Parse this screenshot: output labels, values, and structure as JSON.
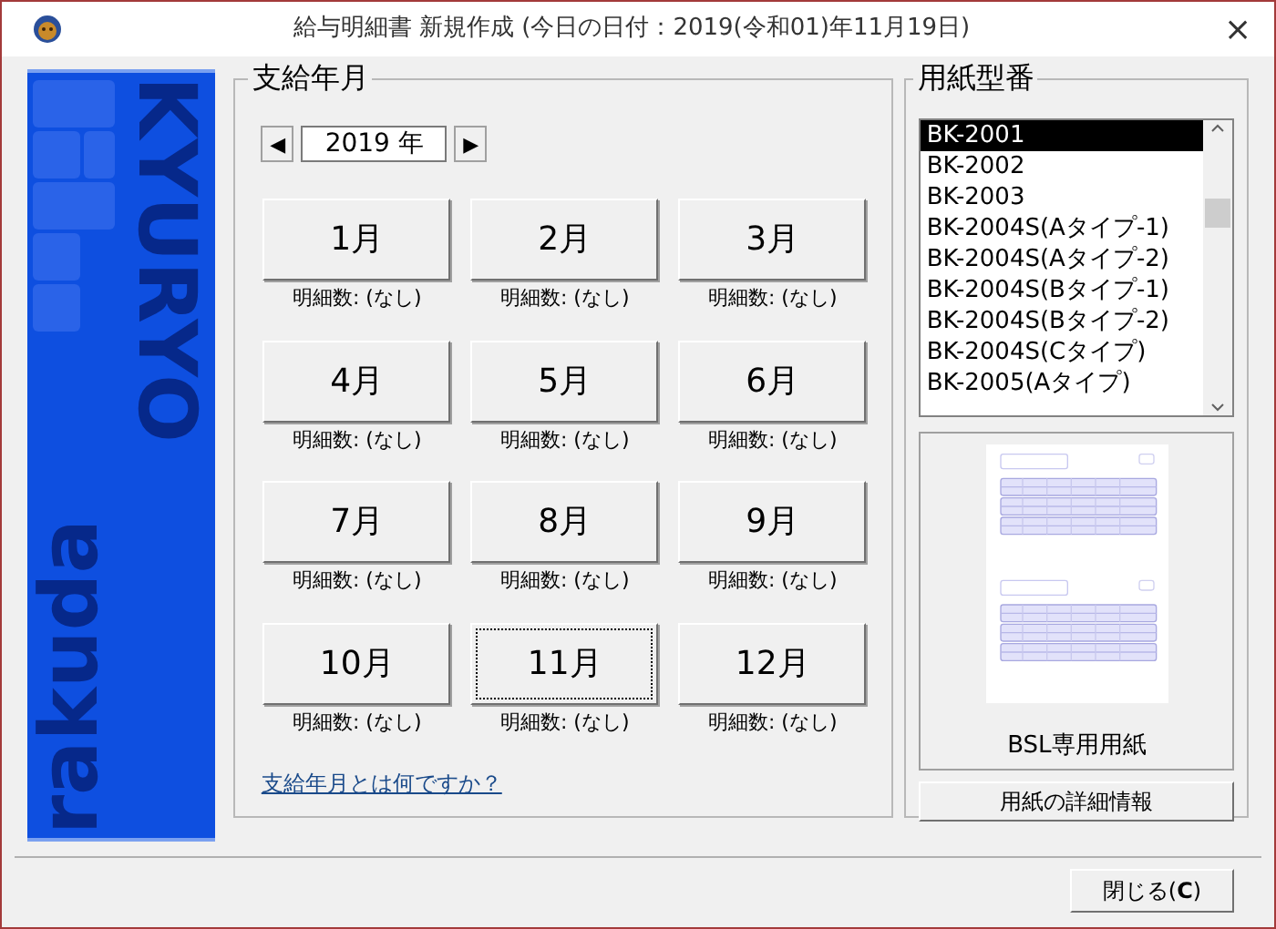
{
  "window": {
    "title": "給与明細書 新規作成 (今日の日付：2019(令和01)年11月19日)",
    "close": "×"
  },
  "banner": {
    "logo_top": "KYURYO",
    "logo_bottom": "rakuda"
  },
  "pay_period": {
    "legend": "支給年月",
    "year": "2019 年",
    "prev": "◀",
    "next": "▶",
    "months": [
      {
        "label": "1月",
        "count": "明細数: (なし)",
        "focused": false
      },
      {
        "label": "2月",
        "count": "明細数: (なし)",
        "focused": false
      },
      {
        "label": "3月",
        "count": "明細数: (なし)",
        "focused": false
      },
      {
        "label": "4月",
        "count": "明細数: (なし)",
        "focused": false
      },
      {
        "label": "5月",
        "count": "明細数: (なし)",
        "focused": false
      },
      {
        "label": "6月",
        "count": "明細数: (なし)",
        "focused": false
      },
      {
        "label": "7月",
        "count": "明細数: (なし)",
        "focused": false
      },
      {
        "label": "8月",
        "count": "明細数: (なし)",
        "focused": false
      },
      {
        "label": "9月",
        "count": "明細数: (なし)",
        "focused": false
      },
      {
        "label": "10月",
        "count": "明細数: (なし)",
        "focused": false
      },
      {
        "label": "11月",
        "count": "明細数: (なし)",
        "focused": true
      },
      {
        "label": "12月",
        "count": "明細数: (なし)",
        "focused": false
      }
    ],
    "help_link": "支給年月とは何ですか？"
  },
  "paper": {
    "legend": "用紙型番",
    "items": [
      {
        "label": "BK-2001",
        "selected": true
      },
      {
        "label": "BK-2002",
        "selected": false
      },
      {
        "label": "BK-2003",
        "selected": false
      },
      {
        "label": "BK-2004S(Aタイプ-1)",
        "selected": false
      },
      {
        "label": "BK-2004S(Aタイプ-2)",
        "selected": false
      },
      {
        "label": "BK-2004S(Bタイプ-1)",
        "selected": false
      },
      {
        "label": "BK-2004S(Bタイプ-2)",
        "selected": false
      },
      {
        "label": "BK-2004S(Cタイプ)",
        "selected": false
      },
      {
        "label": "BK-2005(Aタイプ)",
        "selected": false
      }
    ],
    "preview_caption": "BSL専用用紙",
    "details_button": "用紙の詳細情報"
  },
  "footer": {
    "close_button": "閉じる(**C**)"
  }
}
